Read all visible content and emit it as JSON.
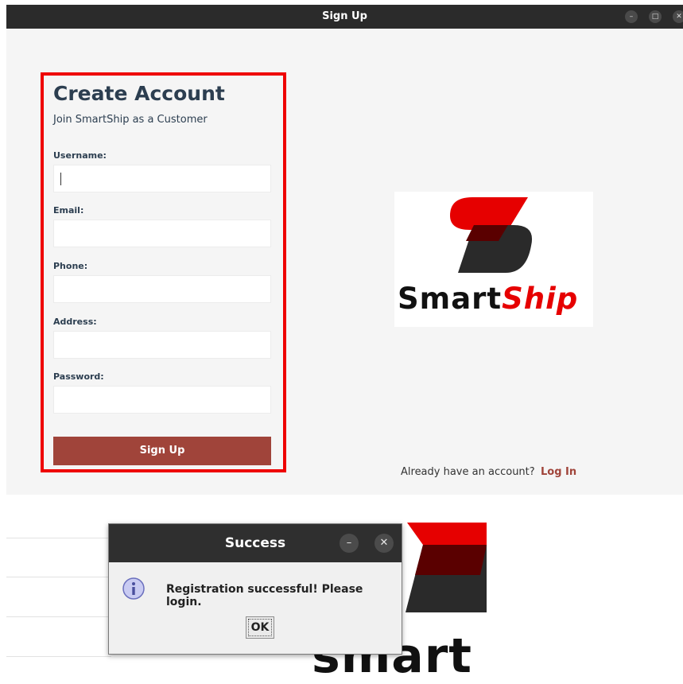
{
  "window": {
    "title": "Sign Up",
    "minimize_glyph": "–",
    "maximize_glyph": "□",
    "close_glyph": "✕"
  },
  "form": {
    "heading": "Create Account",
    "subheading": "Join SmartShip as a Customer",
    "username_label": "Username:",
    "email_label": "Email:",
    "phone_label": "Phone:",
    "address_label": "Address:",
    "password_label": "Password:",
    "submit_label": "Sign Up"
  },
  "logo": {
    "word_dark": "Smart",
    "word_red": "Ship",
    "partial_text": "smart"
  },
  "footer": {
    "prompt": "Already have an account?",
    "login_link": "Log In"
  },
  "dialog": {
    "title": "Success",
    "message": "Registration successful! Please login.",
    "ok_label": "OK",
    "minimize_glyph": "–",
    "close_glyph": "✕",
    "icon": "info-icon"
  },
  "colors": {
    "accent_button": "#a0443a",
    "highlight_border": "#ee0000",
    "logo_red": "#e60000",
    "heading": "#2c3e50"
  }
}
